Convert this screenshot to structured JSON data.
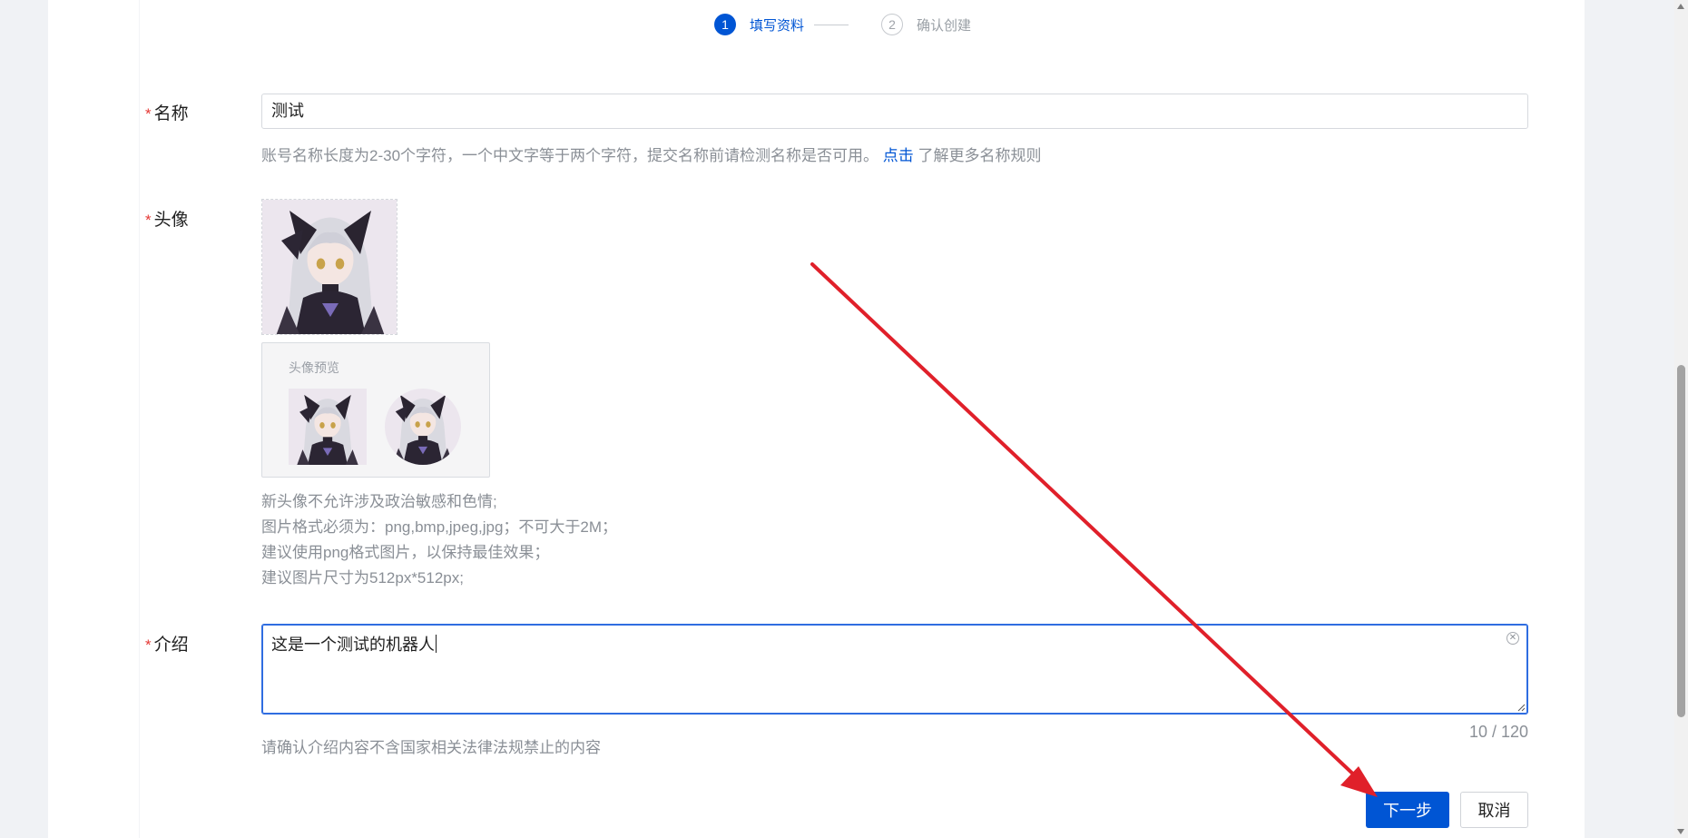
{
  "steps": [
    {
      "number": "1",
      "label": "填写资料",
      "state": "active"
    },
    {
      "number": "2",
      "label": "确认创建",
      "state": "inactive"
    }
  ],
  "name_field": {
    "label": "名称",
    "value": "测试",
    "hint_text": "账号名称长度为2-30个字符，一个中文字等于两个字符，提交名称前请检测名称是否可用。",
    "hint_link": "点击",
    "hint_suffix": "了解更多名称规则"
  },
  "avatar_field": {
    "label": "头像",
    "preview_title": "头像预览",
    "rules": [
      "新头像不允许涉及政治敏感和色情;",
      "图片格式必须为：png,bmp,jpeg,jpg；不可大于2M；",
      "建议使用png格式图片，以保持最佳效果；",
      "建议图片尺寸为512px*512px;"
    ]
  },
  "intro_field": {
    "label": "介绍",
    "value": "这是一个测试的机器人",
    "counter": "10 / 120",
    "hint": "请确认介绍内容不含国家相关法律法规禁止的内容"
  },
  "actions": {
    "next_label": "下一步",
    "cancel_label": "取消"
  },
  "required_mark": "*",
  "colors": {
    "primary": "#0055d4",
    "required": "#e53935",
    "annotation_arrow": "#e0202a"
  }
}
